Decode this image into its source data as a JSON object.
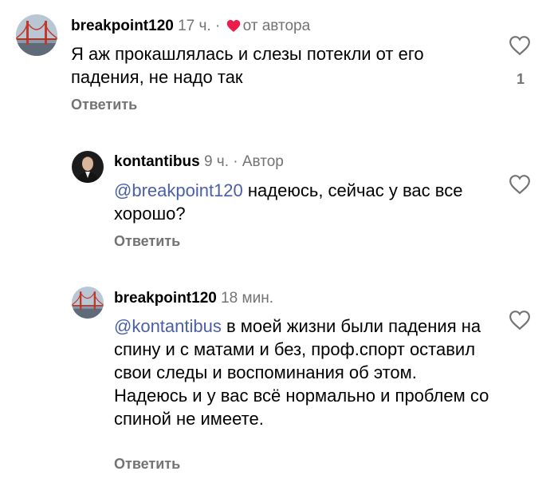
{
  "comments": [
    {
      "username": "breakpoint120",
      "time": "17 ч.",
      "separator": "·",
      "liked_by_author_label": "от автора",
      "text": "Я аж прокашлялась и слезы потекли от его падения, не надо так",
      "reply_label": "Ответить",
      "like_count": "1"
    },
    {
      "username": "kontantibus",
      "time": "9 ч.",
      "separator": "·",
      "author_badge": "Автор",
      "mention": "@breakpoint120",
      "text": " надеюсь, сейчас у вас все хорошо?",
      "reply_label": "Ответить"
    },
    {
      "username": "breakpoint120",
      "time": "18 мин.",
      "mention": "@kontantibus",
      "text": " в моей жизни были падения на спину и с матами и без, проф.спорт оставил свои следы и воспоминания об этом. Надеюсь и у вас всё нормально и проблем со спиной не имеете.",
      "reply_label": "Ответить"
    }
  ],
  "icons": {
    "like": "heart-outline-icon",
    "author_like": "heart-filled-icon"
  },
  "colors": {
    "mention": "#4a5fa8",
    "meta": "#737373",
    "author_heart": "#ed1c4b"
  }
}
